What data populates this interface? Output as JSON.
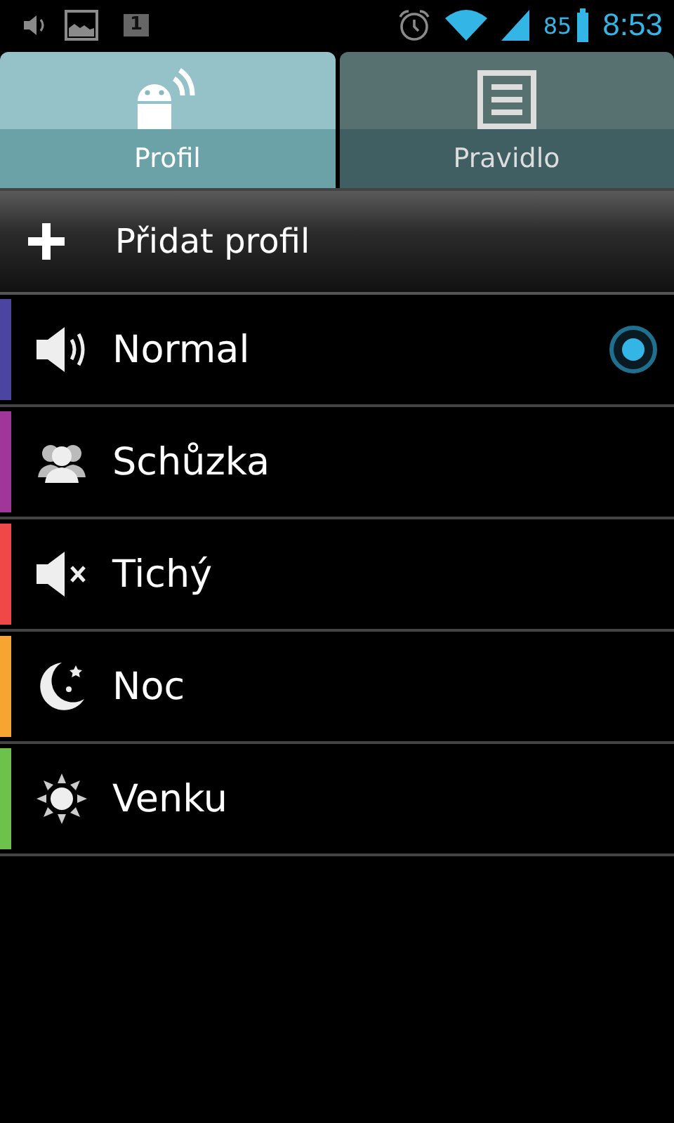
{
  "status_bar": {
    "calendar_day": "1",
    "battery_percent": "85",
    "time": "8:53"
  },
  "tabs": [
    {
      "label": "Profil",
      "kind": "profile",
      "selected": true
    },
    {
      "label": "Pravidlo",
      "kind": "rule",
      "selected": false
    }
  ],
  "add_profile": {
    "label": "Přidat profil"
  },
  "profiles": [
    {
      "name": "Normal",
      "kind": "sound",
      "color": "#4b44a0",
      "selected": true
    },
    {
      "name": "Schůzka",
      "kind": "meeting",
      "color": "#a0369a",
      "selected": false
    },
    {
      "name": "Tichý",
      "kind": "mute",
      "color": "#f04848",
      "selected": false
    },
    {
      "name": "Noc",
      "kind": "night",
      "color": "#f6a533",
      "selected": false
    },
    {
      "name": "Venku",
      "kind": "outdoor",
      "color": "#6cc24a",
      "selected": false
    }
  ]
}
